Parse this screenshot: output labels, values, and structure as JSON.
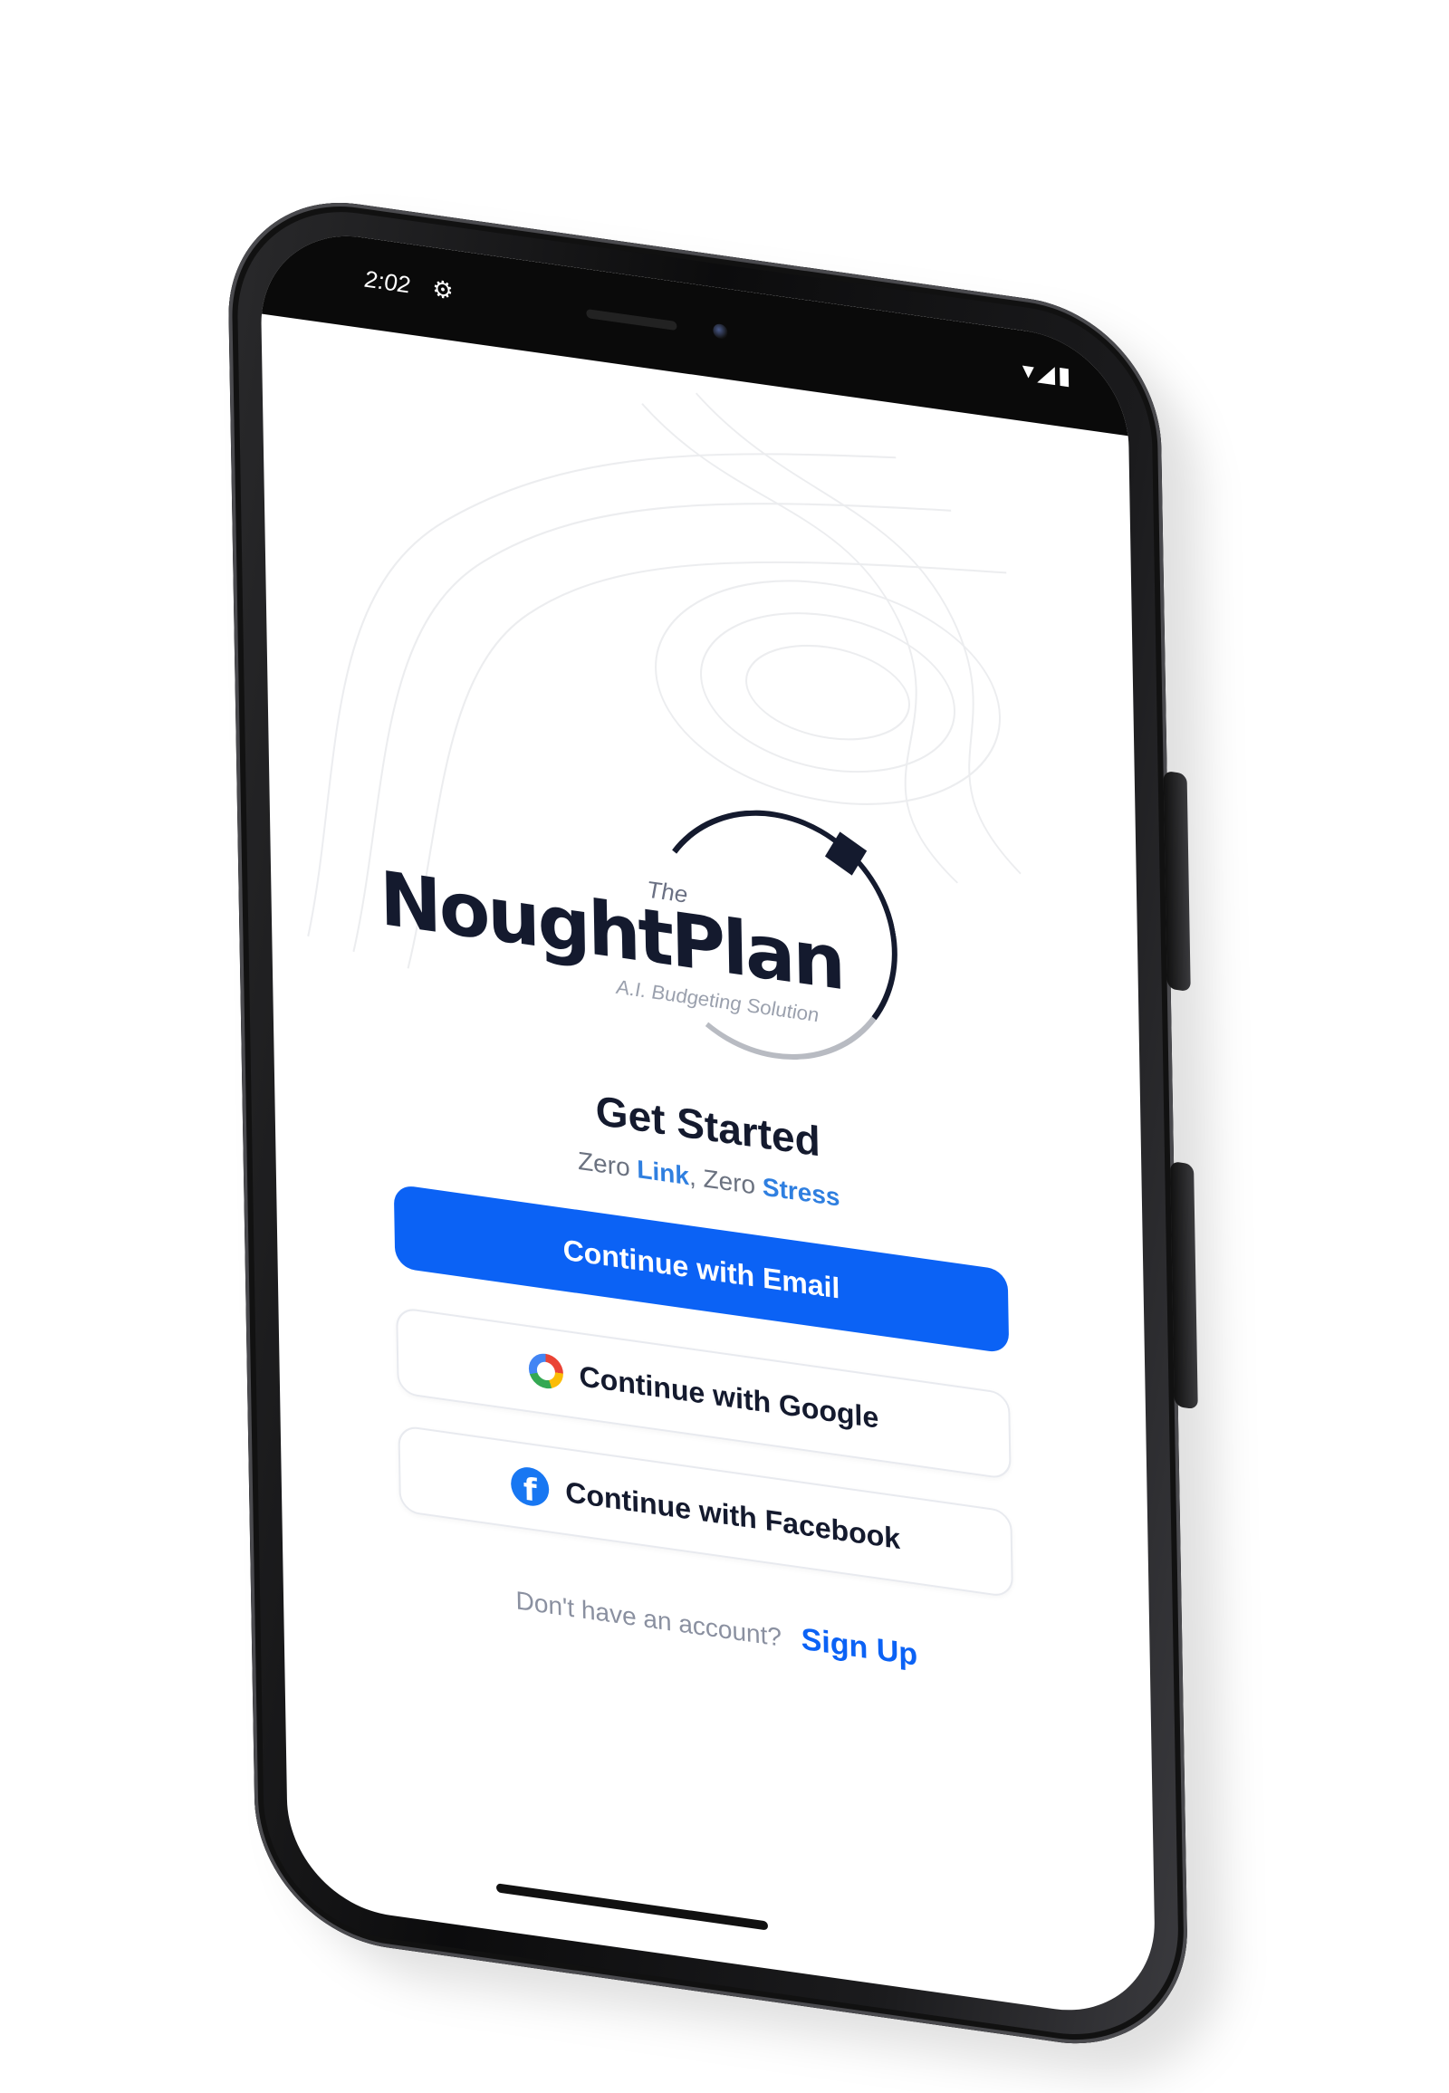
{
  "status_bar": {
    "time": "2:02",
    "gear_icon": "⚙",
    "right_icons": "▾◢▮"
  },
  "logo": {
    "prefix": "The",
    "name": "NoughtPlan",
    "tagline": "A.I. Budgeting Solution"
  },
  "hero": {
    "title": "Get Started",
    "subtitle_part1": "Zero ",
    "subtitle_highlight1": "Link",
    "subtitle_part2": ", Zero ",
    "subtitle_highlight2": "Stress"
  },
  "auth": {
    "email_label": "Continue with Email",
    "google_label": "Continue with Google",
    "facebook_label": "Continue with Facebook",
    "facebook_glyph": "f"
  },
  "signup": {
    "prompt": "Don't have an account?",
    "link_label": "Sign Up"
  },
  "colors": {
    "primary": "#0b62f5",
    "accent_text": "#2f7fe0",
    "brand_dark": "#141a2e"
  }
}
